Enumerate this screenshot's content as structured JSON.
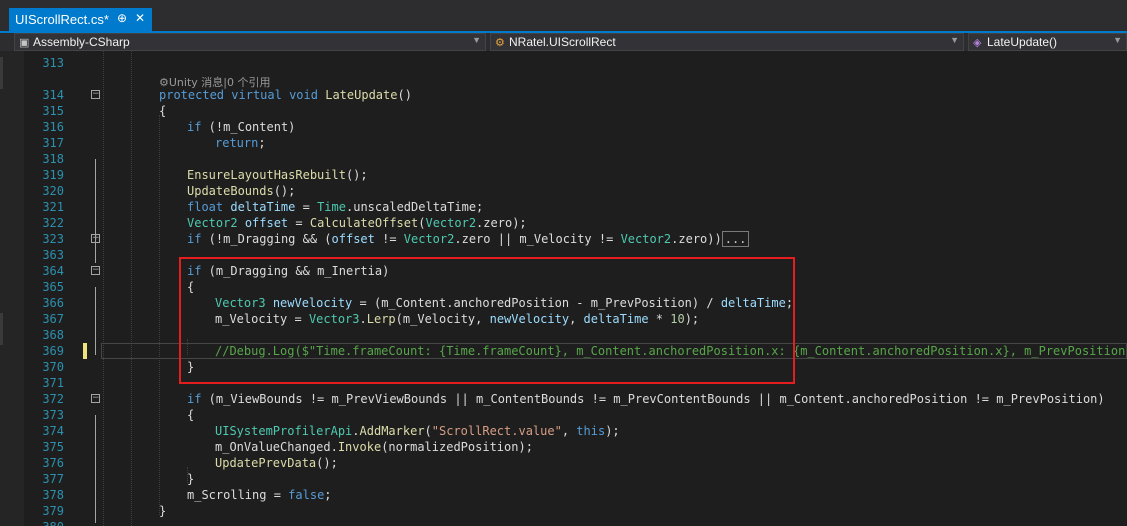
{
  "tab": {
    "title": "UIScrollRect.cs*",
    "pin_glyph": "⊕",
    "close_glyph": "✕"
  },
  "navbar": {
    "project": "Assembly-CSharp",
    "type": "NRatel.UIScrollRect",
    "member": "LateUpdate()"
  },
  "codelens": "⚙Unity 消息|0 个引用",
  "colors": {
    "keyword": "#569cd6",
    "type": "#4ec9b0",
    "method": "#dcdcaa",
    "field": "#dcdcdc",
    "local": "#9cdcfe",
    "string": "#d69d85",
    "number": "#b5cea8",
    "comment": "#57a64a",
    "line_number": "#2b91af",
    "highlight_box": "#e41e1e",
    "accent": "#007acc"
  },
  "lines": [
    {
      "n": "313",
      "fold": "",
      "indent": 0,
      "tokens": []
    },
    {
      "n": "314",
      "fold": "minus",
      "indent": 0,
      "tokens": [
        [
          "kw",
          "protected"
        ],
        [
          "pl",
          " "
        ],
        [
          "kw",
          "virtual"
        ],
        [
          "pl",
          " "
        ],
        [
          "kw",
          "void"
        ],
        [
          "pl",
          " "
        ],
        [
          "mt",
          "LateUpdate"
        ],
        [
          "pl",
          "()"
        ]
      ]
    },
    {
      "n": "315",
      "fold": "",
      "indent": 0,
      "tokens": [
        [
          "pl",
          "{"
        ]
      ]
    },
    {
      "n": "316",
      "fold": "",
      "indent": 1,
      "tokens": [
        [
          "kw",
          "if"
        ],
        [
          "pl",
          " (!"
        ],
        [
          "ft",
          "m_Content"
        ],
        [
          "pl",
          ")"
        ]
      ]
    },
    {
      "n": "317",
      "fold": "",
      "indent": 2,
      "tokens": [
        [
          "kw",
          "return"
        ],
        [
          "pl",
          ";"
        ]
      ]
    },
    {
      "n": "318",
      "fold": "",
      "indent": 0,
      "tokens": []
    },
    {
      "n": "319",
      "fold": "",
      "indent": 1,
      "tokens": [
        [
          "mt",
          "EnsureLayoutHasRebuilt"
        ],
        [
          "pl",
          "();"
        ]
      ]
    },
    {
      "n": "320",
      "fold": "",
      "indent": 1,
      "tokens": [
        [
          "mt",
          "UpdateBounds"
        ],
        [
          "pl",
          "();"
        ]
      ]
    },
    {
      "n": "321",
      "fold": "",
      "indent": 1,
      "tokens": [
        [
          "kw",
          "float"
        ],
        [
          "pl",
          " "
        ],
        [
          "lc",
          "deltaTime"
        ],
        [
          "pl",
          " = "
        ],
        [
          "ty",
          "Time"
        ],
        [
          "pl",
          "."
        ],
        [
          "ft",
          "unscaledDeltaTime"
        ],
        [
          "pl",
          ";"
        ]
      ]
    },
    {
      "n": "322",
      "fold": "",
      "indent": 1,
      "tokens": [
        [
          "ty",
          "Vector2"
        ],
        [
          "pl",
          " "
        ],
        [
          "lc",
          "offset"
        ],
        [
          "pl",
          " = "
        ],
        [
          "mt",
          "CalculateOffset"
        ],
        [
          "pl",
          "("
        ],
        [
          "ty",
          "Vector2"
        ],
        [
          "pl",
          "."
        ],
        [
          "ft",
          "zero"
        ],
        [
          "pl",
          ");"
        ]
      ]
    },
    {
      "n": "323",
      "fold": "plus",
      "indent": 1,
      "tokens": [
        [
          "kw",
          "if"
        ],
        [
          "pl",
          " (!"
        ],
        [
          "ft",
          "m_Dragging"
        ],
        [
          "pl",
          " && ("
        ],
        [
          "lc",
          "offset"
        ],
        [
          "pl",
          " != "
        ],
        [
          "ty",
          "Vector2"
        ],
        [
          "pl",
          "."
        ],
        [
          "ft",
          "zero"
        ],
        [
          "pl",
          " || "
        ],
        [
          "ft",
          "m_Velocity"
        ],
        [
          "pl",
          " != "
        ],
        [
          "ty",
          "Vector2"
        ],
        [
          "pl",
          "."
        ],
        [
          "ft",
          "zero"
        ],
        [
          "pl",
          "))"
        ],
        [
          "ellipsis",
          "..."
        ]
      ]
    },
    {
      "n": "363",
      "fold": "",
      "indent": 0,
      "tokens": []
    },
    {
      "n": "364",
      "fold": "minus",
      "indent": 1,
      "tokens": [
        [
          "kw",
          "if"
        ],
        [
          "pl",
          " ("
        ],
        [
          "ft",
          "m_Dragging"
        ],
        [
          "pl",
          " && "
        ],
        [
          "ft",
          "m_Inertia"
        ],
        [
          "pl",
          ")"
        ]
      ]
    },
    {
      "n": "365",
      "fold": "",
      "indent": 1,
      "tokens": [
        [
          "pl",
          "{"
        ]
      ]
    },
    {
      "n": "366",
      "fold": "",
      "indent": 2,
      "tokens": [
        [
          "ty",
          "Vector3"
        ],
        [
          "pl",
          " "
        ],
        [
          "lc",
          "newVelocity"
        ],
        [
          "pl",
          " = ("
        ],
        [
          "ft",
          "m_Content"
        ],
        [
          "pl",
          "."
        ],
        [
          "ft",
          "anchoredPosition"
        ],
        [
          "pl",
          " - "
        ],
        [
          "ft",
          "m_PrevPosition"
        ],
        [
          "pl",
          ") / "
        ],
        [
          "lc",
          "deltaTime"
        ],
        [
          "pl",
          ";"
        ]
      ]
    },
    {
      "n": "367",
      "fold": "",
      "indent": 2,
      "tokens": [
        [
          "ft",
          "m_Velocity"
        ],
        [
          "pl",
          " = "
        ],
        [
          "ty",
          "Vector3"
        ],
        [
          "pl",
          "."
        ],
        [
          "mt",
          "Lerp"
        ],
        [
          "pl",
          "("
        ],
        [
          "ft",
          "m_Velocity"
        ],
        [
          "pl",
          ", "
        ],
        [
          "lc",
          "newVelocity"
        ],
        [
          "pl",
          ", "
        ],
        [
          "lc",
          "deltaTime"
        ],
        [
          "pl",
          " * "
        ],
        [
          "num",
          "10"
        ],
        [
          "pl",
          ");"
        ]
      ]
    },
    {
      "n": "368",
      "fold": "",
      "indent": 0,
      "tokens": []
    },
    {
      "n": "369",
      "fold": "",
      "indent": 2,
      "changed": true,
      "current": true,
      "tokens": [
        [
          "cm",
          "//Debug.Log($\"Time.frameCount: {Time.frameCount}, m_Content.anchoredPosition.x: {m_Content.anchoredPosition.x}, m_PrevPosition.x:"
        ]
      ]
    },
    {
      "n": "370",
      "fold": "",
      "indent": 1,
      "tokens": [
        [
          "pl",
          "}"
        ]
      ]
    },
    {
      "n": "371",
      "fold": "",
      "indent": 0,
      "tokens": []
    },
    {
      "n": "372",
      "fold": "minus",
      "indent": 1,
      "tokens": [
        [
          "kw",
          "if"
        ],
        [
          "pl",
          " ("
        ],
        [
          "ft",
          "m_ViewBounds"
        ],
        [
          "pl",
          " != "
        ],
        [
          "ft",
          "m_PrevViewBounds"
        ],
        [
          "pl",
          " || "
        ],
        [
          "ft",
          "m_ContentBounds"
        ],
        [
          "pl",
          " != "
        ],
        [
          "ft",
          "m_PrevContentBounds"
        ],
        [
          "pl",
          " || "
        ],
        [
          "ft",
          "m_Content"
        ],
        [
          "pl",
          "."
        ],
        [
          "ft",
          "anchoredPosition"
        ],
        [
          "pl",
          " != "
        ],
        [
          "ft",
          "m_PrevPosition"
        ],
        [
          "pl",
          ")"
        ]
      ]
    },
    {
      "n": "373",
      "fold": "",
      "indent": 1,
      "tokens": [
        [
          "pl",
          "{"
        ]
      ]
    },
    {
      "n": "374",
      "fold": "",
      "indent": 2,
      "tokens": [
        [
          "ty",
          "UISystemProfilerApi"
        ],
        [
          "pl",
          "."
        ],
        [
          "mt",
          "AddMarker"
        ],
        [
          "pl",
          "("
        ],
        [
          "str",
          "\"ScrollRect.value\""
        ],
        [
          "pl",
          ", "
        ],
        [
          "kw",
          "this"
        ],
        [
          "pl",
          ");"
        ]
      ]
    },
    {
      "n": "375",
      "fold": "",
      "indent": 2,
      "tokens": [
        [
          "ft",
          "m_OnValueChanged"
        ],
        [
          "pl",
          "."
        ],
        [
          "mt",
          "Invoke"
        ],
        [
          "pl",
          "("
        ],
        [
          "ft",
          "normalizedPosition"
        ],
        [
          "pl",
          ");"
        ]
      ]
    },
    {
      "n": "376",
      "fold": "",
      "indent": 2,
      "tokens": [
        [
          "mt",
          "UpdatePrevData"
        ],
        [
          "pl",
          "();"
        ]
      ]
    },
    {
      "n": "377",
      "fold": "",
      "indent": 1,
      "tokens": [
        [
          "pl",
          "}"
        ]
      ]
    },
    {
      "n": "378",
      "fold": "",
      "indent": 1,
      "tokens": [
        [
          "ft",
          "m_Scrolling"
        ],
        [
          "pl",
          " = "
        ],
        [
          "kw",
          "false"
        ],
        [
          "pl",
          ";"
        ]
      ]
    },
    {
      "n": "379",
      "fold": "",
      "indent": 0,
      "tokens": [
        [
          "pl",
          "}"
        ]
      ]
    },
    {
      "n": "380",
      "fold": "",
      "indent": 0,
      "tokens": []
    }
  ]
}
